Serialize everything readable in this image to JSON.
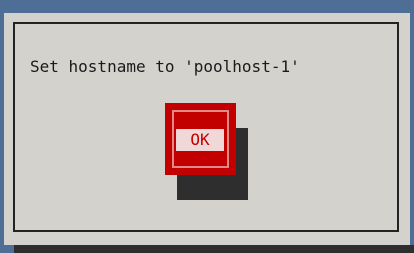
{
  "dialog": {
    "message": "Set hostname to 'poolhost-1'",
    "ok_label": "OK"
  },
  "colors": {
    "background": "#4f6e96",
    "dialog": "#d4d2cc",
    "button": "#c20000",
    "shadow": "#2e2e2e"
  }
}
